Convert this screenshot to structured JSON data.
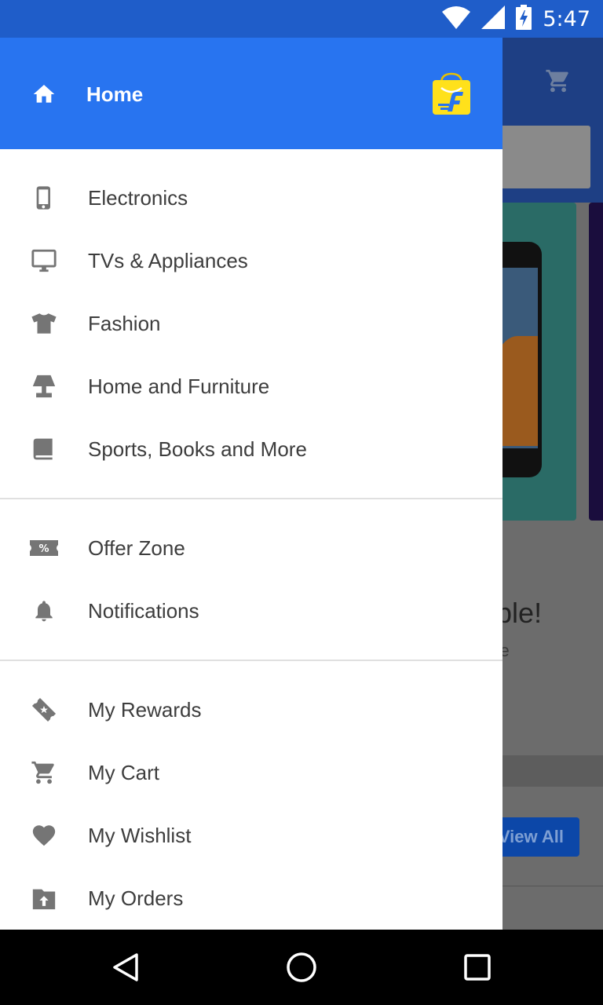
{
  "status_bar": {
    "time": "5:47",
    "icons": [
      "wifi-icon",
      "signal-icon",
      "battery-charging-icon"
    ]
  },
  "background_app": {
    "card_title": "able!",
    "card_subtitle": "one",
    "view_all_label": "View All"
  },
  "drawer": {
    "header": {
      "label": "Home",
      "icon": "home-icon",
      "logo": "flipkart-logo"
    },
    "sections": [
      [
        {
          "label": "Electronics",
          "icon": "phone-icon"
        },
        {
          "label": "TVs & Appliances",
          "icon": "monitor-icon"
        },
        {
          "label": "Fashion",
          "icon": "tshirt-icon"
        },
        {
          "label": "Home and Furniture",
          "icon": "lamp-icon"
        },
        {
          "label": "Sports, Books and More",
          "icon": "book-icon"
        }
      ],
      [
        {
          "label": "Offer Zone",
          "icon": "offer-ticket-icon"
        },
        {
          "label": "Notifications",
          "icon": "bell-icon"
        }
      ],
      [
        {
          "label": "My Rewards",
          "icon": "rewards-ticket-icon"
        },
        {
          "label": "My Cart",
          "icon": "cart-icon"
        },
        {
          "label": "My Wishlist",
          "icon": "heart-icon"
        },
        {
          "label": "My Orders",
          "icon": "orders-box-icon"
        }
      ]
    ]
  },
  "nav_bar": {
    "buttons": [
      "back-icon",
      "home-circle-icon",
      "recents-icon"
    ]
  },
  "colors": {
    "status_bar": "#1f5dc9",
    "drawer_header": "#2874f0",
    "icon_gray": "#757575",
    "text": "#3d3d3d",
    "logo_yellow": "#ffe11b"
  }
}
